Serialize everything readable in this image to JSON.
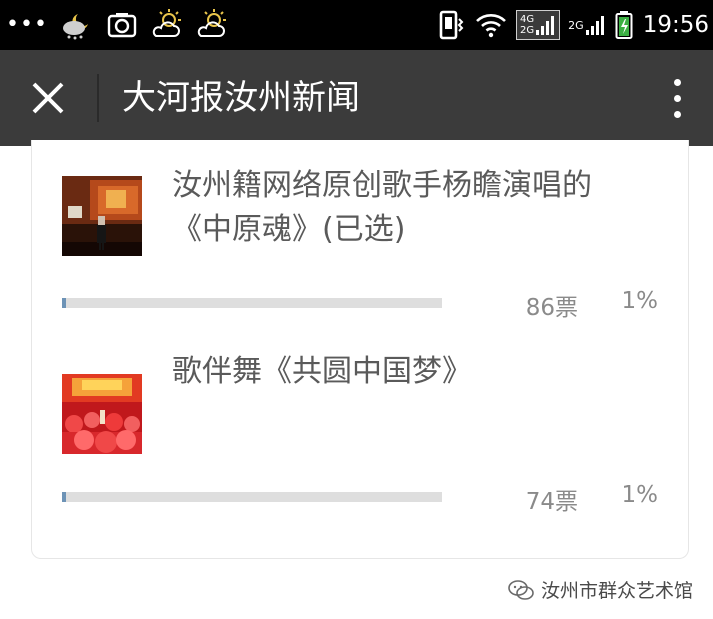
{
  "status_bar": {
    "dots": "•••",
    "network_4g": "4G",
    "network_2g_top": "2G",
    "network_2g": "2G",
    "time": "19:56",
    "icons": [
      "cloudy-moon-icon",
      "camera-icon",
      "partly-sunny-icon",
      "partly-sunny-icon",
      "vibrate-icon",
      "wifi-icon",
      "signal-icon",
      "battery-icon"
    ]
  },
  "header": {
    "title": "大河报汝州新闻"
  },
  "poll": {
    "options": [
      {
        "text": "汝州籍网络原创歌手杨瞻演唱的《中原魂》(已选)",
        "votes": "86票",
        "percent": "1%",
        "fraction": 0.01
      },
      {
        "text": "歌伴舞《共圆中国梦》",
        "votes": "74票",
        "percent": "1%",
        "fraction": 0.01
      }
    ]
  },
  "watermark": {
    "text": "汝州市群众艺术馆"
  },
  "colors": {
    "status_bar": "#000000",
    "title_bar": "#3b3b3b",
    "bar_track": "#dedede",
    "bar_fill": "#6d93b6"
  }
}
